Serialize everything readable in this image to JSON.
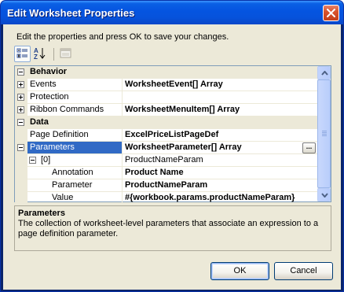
{
  "window": {
    "title": "Edit Worksheet Properties"
  },
  "instructions": "Edit the properties and press OK to save your changes.",
  "toolbar": {
    "categorized_icon": "categorized-icon",
    "alphabetical_icon": "sort-az-icon",
    "property_pages_icon": "property-pages-icon"
  },
  "grid": {
    "rows": [
      {
        "type": "category",
        "name": "Behavior"
      },
      {
        "type": "property",
        "name": "Events",
        "value": "WorksheetEvent[] Array",
        "expander": "plus"
      },
      {
        "type": "property",
        "name": "Protection",
        "value": "",
        "expander": "plus"
      },
      {
        "type": "property",
        "name": "Ribbon Commands",
        "value": "WorksheetMenuItem[] Array",
        "expander": "plus"
      },
      {
        "type": "category",
        "name": "Data"
      },
      {
        "type": "property",
        "name": "Page Definition",
        "value": "ExcelPriceListPageDef"
      },
      {
        "type": "property",
        "name": "Parameters",
        "value": "WorksheetParameter[] Array",
        "expander": "minus",
        "selected": true,
        "ellipsis": "..."
      },
      {
        "type": "property",
        "name": "[0]",
        "value": "ProductNameParam",
        "expander": "minus",
        "indent": 1,
        "value_normal": true
      },
      {
        "type": "property",
        "name": "Annotation",
        "value": "Product Name",
        "indent": 2
      },
      {
        "type": "property",
        "name": "Parameter",
        "value": "ProductNameParam",
        "indent": 2
      },
      {
        "type": "property",
        "name": "Value",
        "value": "#{workbook.params.productNameParam}",
        "indent": 2
      }
    ]
  },
  "description": {
    "title": "Parameters",
    "text": "The collection of worksheet-level parameters that associate an expression to a page definition parameter."
  },
  "buttons": {
    "ok": "OK",
    "cancel": "Cancel"
  },
  "colors": {
    "selection": "#316ac5",
    "titlebar": "#0554e0",
    "face": "#ece9d8"
  }
}
